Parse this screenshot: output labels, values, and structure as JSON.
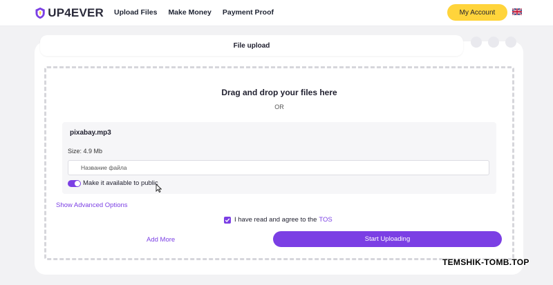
{
  "brand": {
    "name": "UP4EVER",
    "accent": "#7b3fe4",
    "yellow": "#ffd43b"
  },
  "nav": {
    "items": [
      "Upload Files",
      "Make Money",
      "Payment Proof"
    ]
  },
  "header": {
    "account_label": "My Account",
    "language_icon": "uk-flag-icon"
  },
  "upload": {
    "tab_title": "File upload",
    "drop_title": "Drag and drop your files here",
    "drop_or": "OR",
    "file": {
      "name": "pixabay.mp3",
      "size": "Size: 4.9 Mb",
      "name_placeholder": "Название файла",
      "public_label": "Make it available to public",
      "public_enabled": true
    },
    "advanced_label": "Show Advanced Options",
    "tos": {
      "text": "I have read and agree to the",
      "link": "TOS",
      "checked": true
    },
    "add_more_label": "Add More",
    "start_label": "Start Uploading"
  },
  "watermark": "TEMSHIK-TOMB.TOP"
}
